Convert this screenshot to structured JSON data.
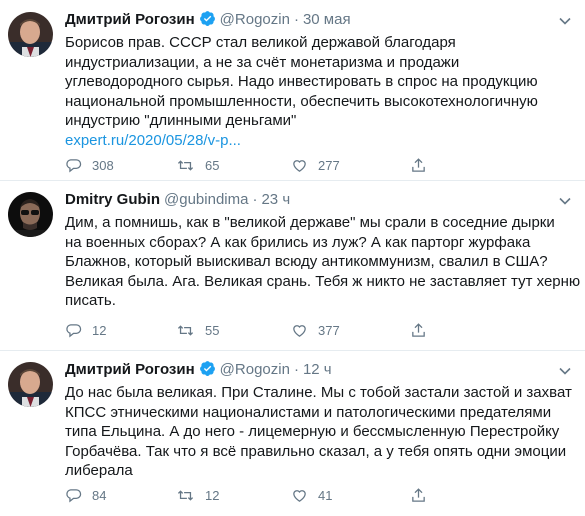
{
  "tweets": [
    {
      "name": "Дмитрий Рогозин",
      "verified": true,
      "handle": "@Rogozin",
      "separator": "·",
      "time": "30 мая",
      "lines": [
        "Борисов прав. СССР стал великой державой благодаря",
        "индустриализации, а не за счёт монетаризма и продажи",
        "углеводородного сырья. Надо инвестировать в спрос на продукцию",
        "национальной промышленности, обеспечить высокотехнологичную",
        "индустрию \"длинными деньгами\""
      ],
      "link": "expert.ru/2020/05/28/v-p...",
      "replies": "308",
      "retweets": "65",
      "likes": "277",
      "avatar_icon": "rogozin-avatar"
    },
    {
      "name": "Dmitry Gubin",
      "verified": false,
      "handle": "@gubindima",
      "separator": "·",
      "time": "23 ч",
      "lines": [
        "Дим, а помнишь, как в \"великой державе\" мы срали в соседние дырки",
        "на военных сборах? А как брились из луж? А как парторг журфака",
        "Блажнов, который выискивал всюду антикоммунизм, свалил в США?",
        "Великая была. Ага. Великая срань. Тебя ж никто не заставляет тут херню",
        "писать."
      ],
      "link": "",
      "replies": "12",
      "retweets": "55",
      "likes": "377",
      "avatar_icon": "gubin-avatar"
    },
    {
      "name": "Дмитрий Рогозин",
      "verified": true,
      "handle": "@Rogozin",
      "separator": "·",
      "time": "12 ч",
      "lines": [
        "До нас была великая. При Сталине. Мы с тобой застали застой и захват",
        "КПСС этническими националистами и патологическими предателями",
        "типа Ельцина. А до него - лицемерную и бессмысленную Перестройку",
        "Горбачёва. Так что я всё правильно сказал, а у тебя опять одни эмоции",
        "либерала"
      ],
      "link": "",
      "replies": "84",
      "retweets": "12",
      "likes": "41",
      "avatar_icon": "rogozin-avatar"
    }
  ],
  "colors": {
    "text": "#14171a",
    "secondary": "#657786",
    "link": "#1b95e0",
    "verified": "#1da1f2",
    "divider": "#e6ecf0"
  }
}
